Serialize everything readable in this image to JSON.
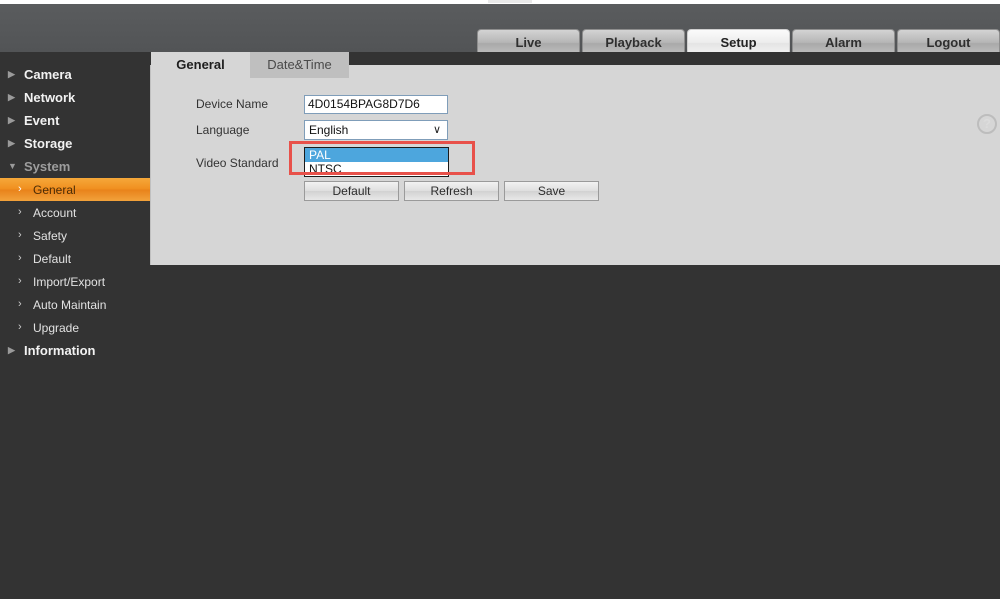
{
  "header": {
    "nav_tabs": [
      {
        "label": "Live",
        "active": false
      },
      {
        "label": "Playback",
        "active": false
      },
      {
        "label": "Setup",
        "active": true
      },
      {
        "label": "Alarm",
        "active": false
      },
      {
        "label": "Logout",
        "active": false
      }
    ]
  },
  "sidebar": {
    "items": [
      {
        "label": "Camera",
        "level": "top",
        "icon": "triangle-right-icon",
        "glyph": "▶",
        "expanded": false,
        "selected": false
      },
      {
        "label": "Network",
        "level": "top",
        "icon": "triangle-right-icon",
        "glyph": "▶",
        "expanded": false,
        "selected": false
      },
      {
        "label": "Event",
        "level": "top",
        "icon": "triangle-right-icon",
        "glyph": "▶",
        "expanded": false,
        "selected": false
      },
      {
        "label": "Storage",
        "level": "top",
        "icon": "triangle-right-icon",
        "glyph": "▶",
        "expanded": false,
        "selected": false
      },
      {
        "label": "System",
        "level": "top",
        "icon": "triangle-down-icon",
        "glyph": "▼",
        "expanded": true,
        "selected": false
      },
      {
        "label": "General",
        "level": "sub",
        "icon": "chevron-right-icon",
        "glyph": "›",
        "expanded": false,
        "selected": true
      },
      {
        "label": "Account",
        "level": "sub",
        "icon": "chevron-right-icon",
        "glyph": "›",
        "expanded": false,
        "selected": false
      },
      {
        "label": "Safety",
        "level": "sub",
        "icon": "chevron-right-icon",
        "glyph": "›",
        "expanded": false,
        "selected": false
      },
      {
        "label": "Default",
        "level": "sub",
        "icon": "chevron-right-icon",
        "glyph": "›",
        "expanded": false,
        "selected": false
      },
      {
        "label": "Import/Export",
        "level": "sub",
        "icon": "chevron-right-icon",
        "glyph": "›",
        "expanded": false,
        "selected": false
      },
      {
        "label": "Auto Maintain",
        "level": "sub",
        "icon": "chevron-right-icon",
        "glyph": "›",
        "expanded": false,
        "selected": false
      },
      {
        "label": "Upgrade",
        "level": "sub",
        "icon": "chevron-right-icon",
        "glyph": "›",
        "expanded": false,
        "selected": false
      },
      {
        "label": "Information",
        "level": "top",
        "icon": "triangle-right-icon",
        "glyph": "▶",
        "expanded": false,
        "selected": false
      }
    ]
  },
  "content": {
    "tabs": [
      {
        "label": "General",
        "active": true
      },
      {
        "label": "Date&Time",
        "active": false
      }
    ],
    "fields": {
      "device_name": {
        "label": "Device Name",
        "value": "4D0154BPAG8D7D6",
        "placeholder": ""
      },
      "language": {
        "label": "Language",
        "value": "English",
        "caret": "∨",
        "options": [
          "English"
        ]
      },
      "video_standard": {
        "label": "Video Standard",
        "options": [
          {
            "label": "PAL",
            "selected": true
          },
          {
            "label": "NTSC",
            "selected": false
          }
        ]
      }
    },
    "buttons": [
      {
        "label": "Default"
      },
      {
        "label": "Refresh"
      },
      {
        "label": "Save"
      }
    ]
  },
  "help": {
    "glyph": "?"
  },
  "annotation": {
    "highlight_color": "#e8514a"
  },
  "colors": {
    "accent_orange": "#f08e1e",
    "select_highlight": "#4da6dd",
    "header_bar": "#555759",
    "body_bg": "#333333",
    "panel_bg": "#d6d6d6"
  }
}
